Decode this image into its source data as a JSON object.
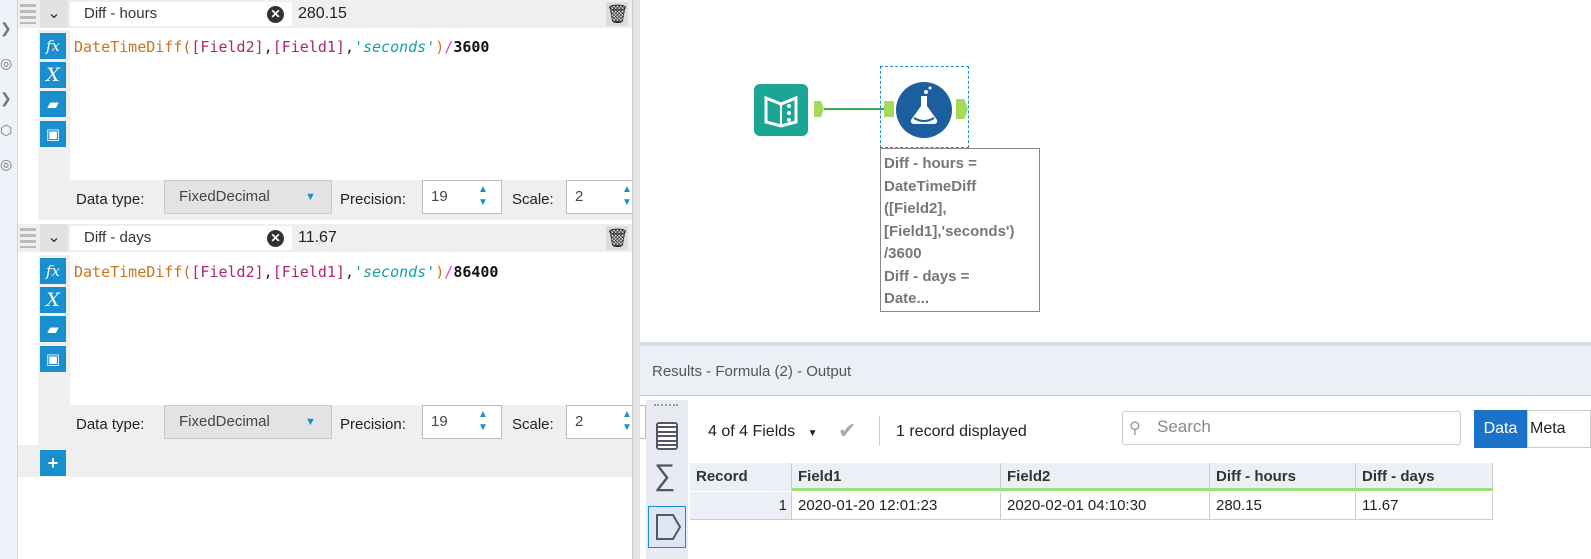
{
  "expressions": [
    {
      "name": "Diff - hours",
      "preview": "280.15",
      "code": {
        "fn": "DateTimeDiff",
        "a1": "[Field2]",
        "a2": "[Field1]",
        "unit": "'seconds'",
        "op": "/",
        "num": "3600"
      },
      "data_type_label": "Data type:",
      "data_type": "FixedDecimal",
      "precision_label": "Precision:",
      "precision": "19",
      "scale_label": "Scale:",
      "scale": "2"
    },
    {
      "name": "Diff - days",
      "preview": "11.67",
      "code": {
        "fn": "DateTimeDiff",
        "a1": "[Field2]",
        "a2": "[Field1]",
        "unit": "'seconds'",
        "op": "/",
        "num": "86400"
      },
      "data_type_label": "Data type:",
      "data_type": "FixedDecimal",
      "precision_label": "Precision:",
      "precision": "19",
      "scale_label": "Scale:",
      "scale": "2"
    }
  ],
  "add_label": "+",
  "canvas": {
    "annotation": [
      "Diff - hours =",
      "DateTimeDiff",
      "([Field2],",
      "[Field1],'seconds')",
      "/3600",
      "Diff - days =",
      "Date..."
    ]
  },
  "results": {
    "title": "Results - Formula (2) - Output",
    "fields_label": "4 of 4 Fields",
    "records_label": "1 record displayed",
    "search_placeholder": "Search",
    "tab_data": "Data",
    "tab_meta": "Meta",
    "columns": [
      "Record",
      "Field1",
      "Field2",
      "Diff - hours",
      "Diff - days"
    ],
    "rows": [
      [
        "1",
        "2020-01-20 12:01:23",
        "2020-02-01 04:10:30",
        "280.15",
        "11.67"
      ]
    ]
  },
  "colors": {
    "accent": "#1a8fd0",
    "input_tool": "#1aa594",
    "formula_tool": "#1b5f9e",
    "connector": "#a6d95a"
  }
}
